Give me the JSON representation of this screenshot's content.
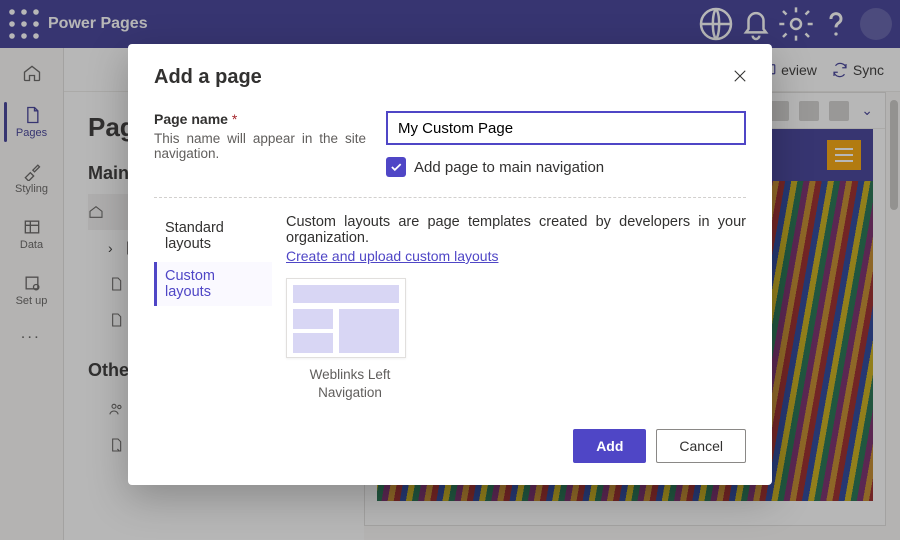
{
  "app": {
    "name": "Power Pages"
  },
  "topbar": {
    "icons": [
      "globe-icon",
      "bell-icon",
      "gear-icon",
      "help-icon"
    ]
  },
  "rail": {
    "home_label": "",
    "items": [
      {
        "label": "Pages",
        "icon": "page-icon",
        "selected": true
      },
      {
        "label": "Styling",
        "icon": "brush-icon",
        "selected": false
      },
      {
        "label": "Data",
        "icon": "table-icon",
        "selected": false
      },
      {
        "label": "Set up",
        "icon": "gear2-icon",
        "selected": false
      }
    ]
  },
  "cmdbar": {
    "preview_label": "eview",
    "sync_label": "Sync"
  },
  "pagesPanel": {
    "title": "Page",
    "main_navigation_label": "Main n",
    "other_pages_label": "Other"
  },
  "modal": {
    "title": "Add a page",
    "page_name_label": "Page name",
    "required_mark": "*",
    "page_name_help": "This name will appear in the site navigation.",
    "page_name_value": "My Custom Page",
    "add_to_nav_label": "Add page to main navigation",
    "add_to_nav_checked": true,
    "tabs": {
      "standard": "Standard layouts",
      "custom": "Custom layouts",
      "selected": "custom"
    },
    "custom_desc": "Custom layouts are page templates created by developers in your organization.",
    "custom_link": "Create and upload custom layouts",
    "layouts": [
      {
        "name": "Weblinks Left Navigation"
      }
    ],
    "add_button": "Add",
    "cancel_button": "Cancel"
  }
}
